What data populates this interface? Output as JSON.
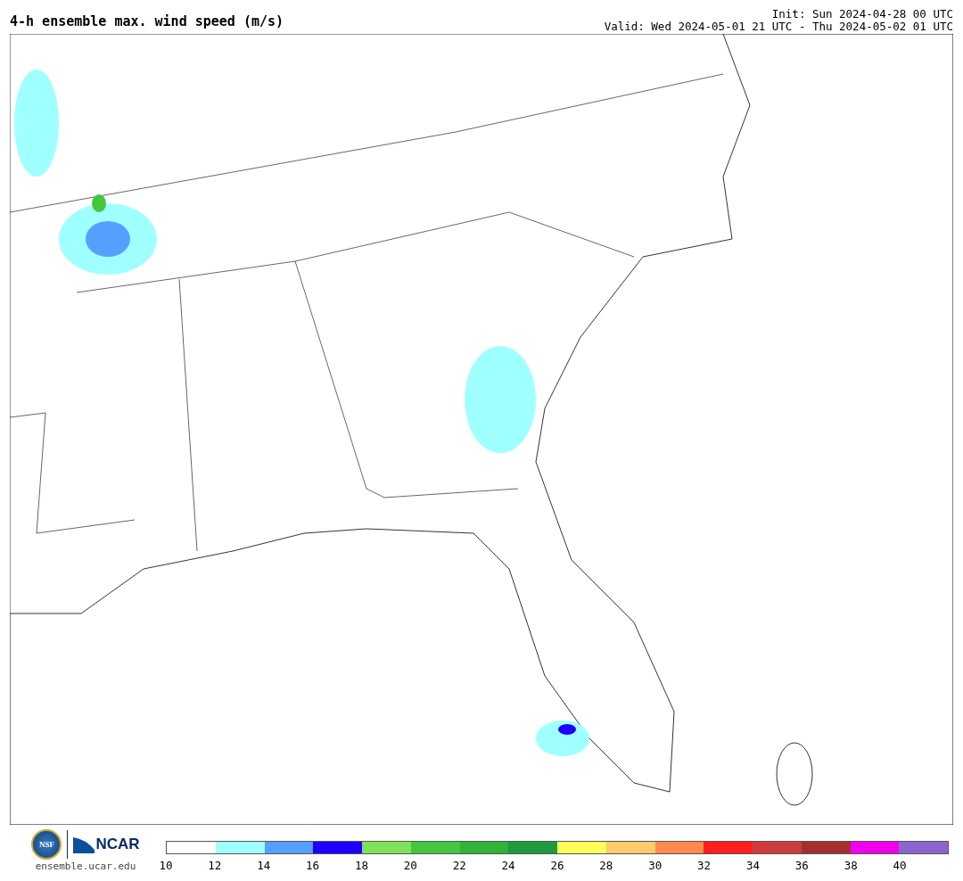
{
  "header": {
    "title": "4-h ensemble max. wind speed (m/s)",
    "init": "Init: Sun 2024-04-28 00 UTC",
    "valid": "Valid: Wed 2024-05-01 21 UTC - Thu 2024-05-02 01 UTC"
  },
  "logos": {
    "nsf": "NSF",
    "ncar": "NCAR",
    "site": "ensemble.ucar.edu"
  },
  "colorbar": {
    "segments": [
      {
        "color": "#ffffff"
      },
      {
        "color": "#a0ffff"
      },
      {
        "color": "#55a0ff"
      },
      {
        "color": "#1e00ff"
      },
      {
        "color": "#7ee35a"
      },
      {
        "color": "#46c540"
      },
      {
        "color": "#2fb33a"
      },
      {
        "color": "#1f9a3e"
      },
      {
        "color": "#ffff5a"
      },
      {
        "color": "#ffcb6a"
      },
      {
        "color": "#ff8a50"
      },
      {
        "color": "#ff1e1e"
      },
      {
        "color": "#cc3c3c"
      },
      {
        "color": "#a52f2f"
      },
      {
        "color": "#ee00ee"
      },
      {
        "color": "#8a66cc"
      }
    ],
    "ticks": [
      "10",
      "12",
      "14",
      "16",
      "18",
      "20",
      "22",
      "24",
      "26",
      "28",
      "30",
      "32",
      "34",
      "36",
      "38",
      "40"
    ]
  }
}
